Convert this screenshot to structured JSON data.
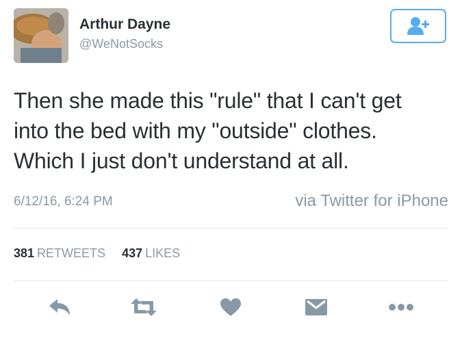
{
  "user": {
    "display_name": "Arthur Dayne",
    "handle": "@WeNotSocks",
    "avatar_icon": "profile-photo"
  },
  "follow_button": {
    "icon": "follow-user-icon"
  },
  "tweet": {
    "lines": [
      "Then she made this \"rule\" that I can't get",
      "into the bed with my \"outside\" clothes.",
      "Which I just don't understand at all."
    ],
    "timestamp": "6/12/16, 6:24 PM",
    "source": "via Twitter for iPhone"
  },
  "stats": {
    "retweets_count": "381",
    "retweets_label": "RETWEETS",
    "likes_count": "437",
    "likes_label": "LIKES"
  },
  "actions": [
    "reply-icon",
    "retweet-icon",
    "like-icon",
    "message-icon",
    "more-icon"
  ],
  "colors": {
    "text": "#292f33",
    "secondary": "#8899a6",
    "accent": "#55acee",
    "divider": "#e1e8ed"
  }
}
